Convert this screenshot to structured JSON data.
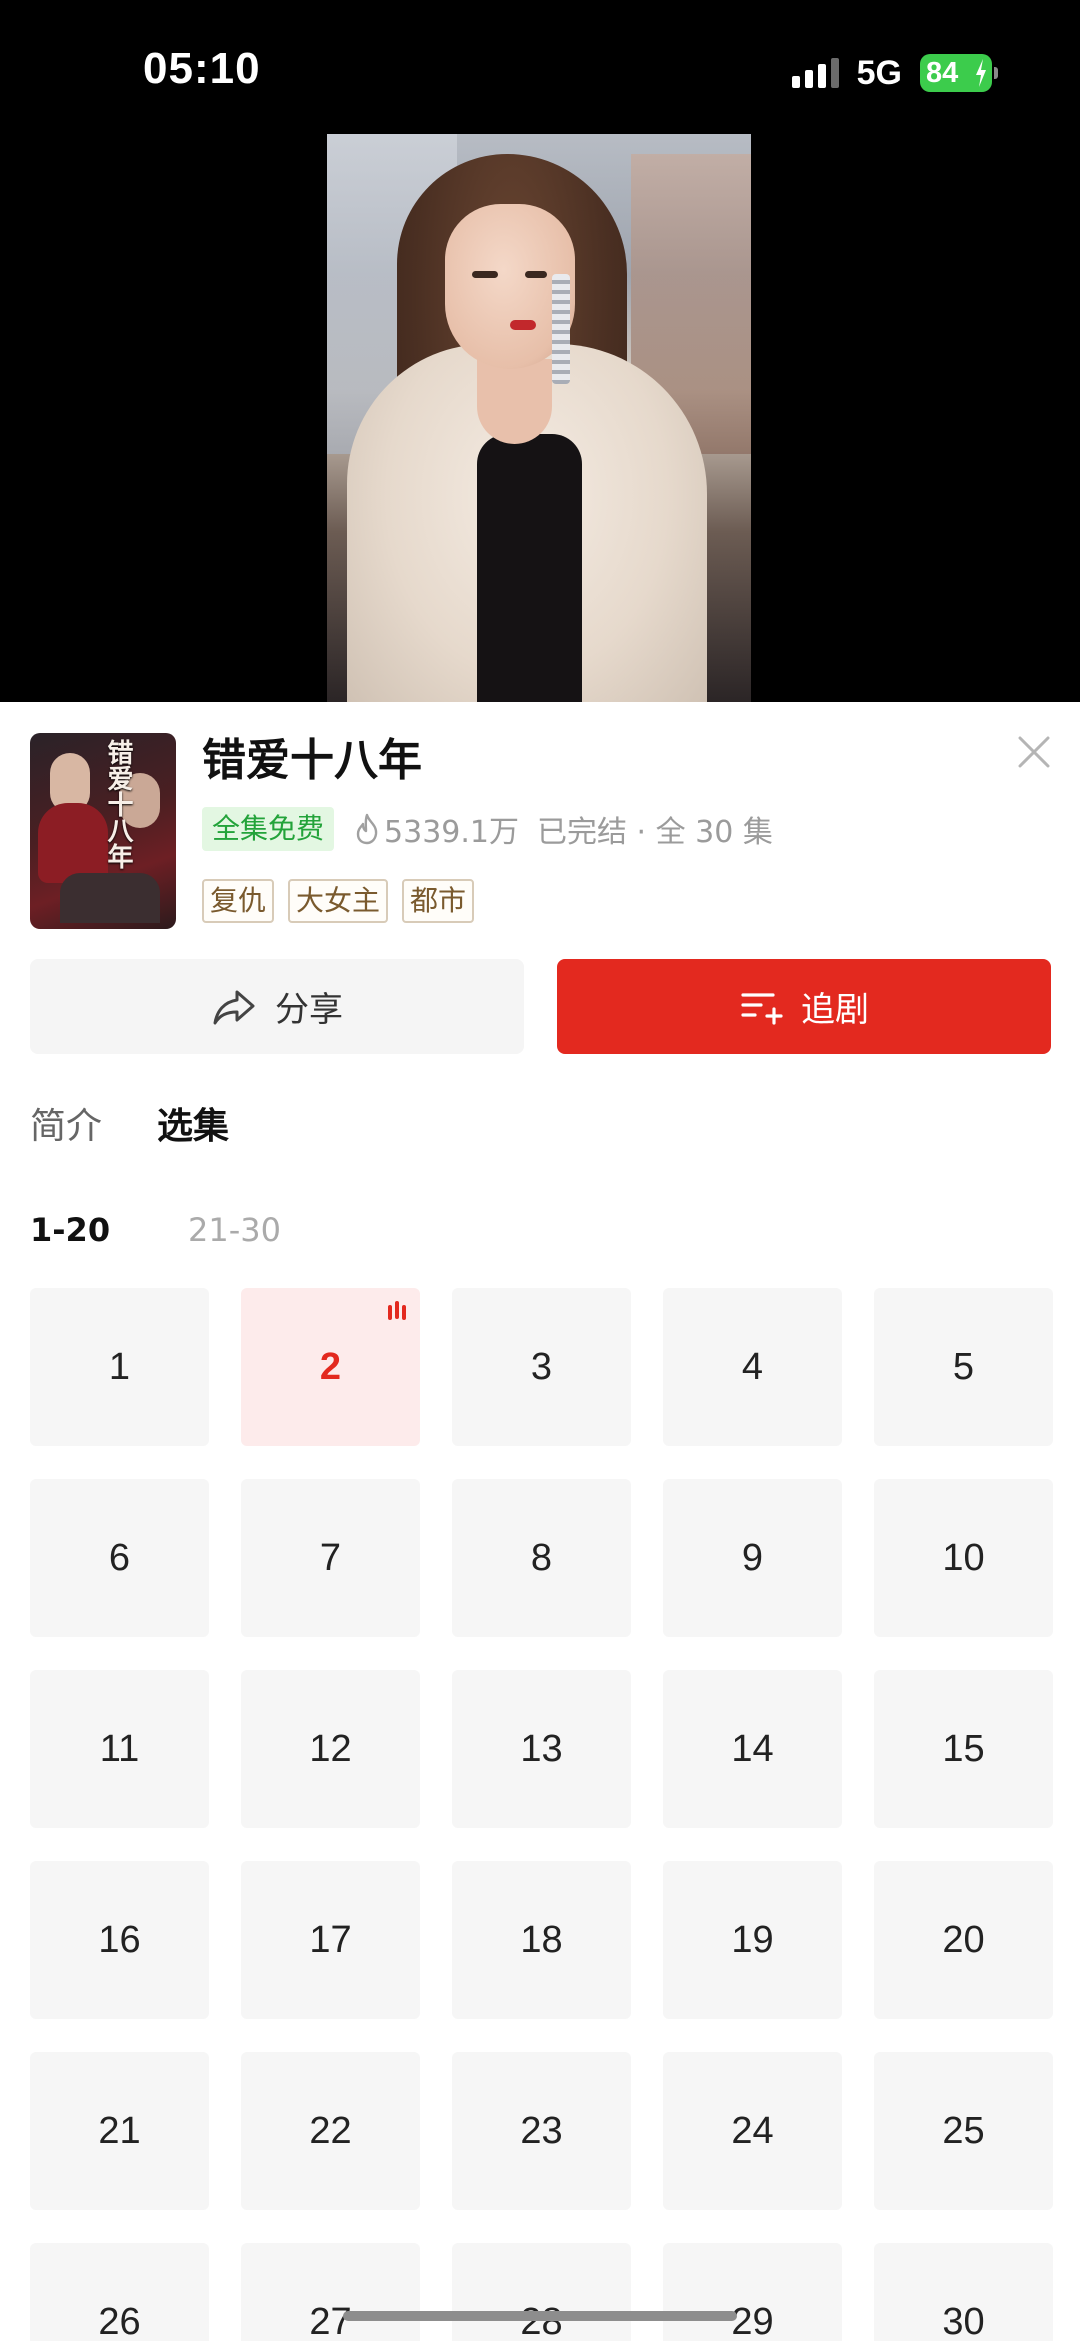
{
  "status_bar": {
    "time": "05:10",
    "network": "5G",
    "battery": "84"
  },
  "drama": {
    "cover_text": "错爱十八年",
    "title": "错爱十八年",
    "free_badge": "全集免费",
    "views": "5339.1万",
    "status": "已完结 · 全 30 集",
    "tags": [
      "复仇",
      "大女主",
      "都市"
    ]
  },
  "actions": {
    "share_label": "分享",
    "follow_label": "追剧"
  },
  "tabs": {
    "intro": "简介",
    "episodes": "选集"
  },
  "ranges": [
    "1-20",
    "21-30"
  ],
  "episodes": [
    "1",
    "2",
    "3",
    "4",
    "5",
    "6",
    "7",
    "8",
    "9",
    "10",
    "11",
    "12",
    "13",
    "14",
    "15",
    "16",
    "17",
    "18",
    "19",
    "20",
    "21",
    "22",
    "23",
    "24",
    "25",
    "26",
    "27",
    "28",
    "29",
    "30"
  ],
  "current_episode": "2",
  "icons": [
    "signal-icon",
    "battery-icon",
    "close-icon",
    "flame-icon",
    "share-icon",
    "add-to-list-icon",
    "playing-icon"
  ],
  "colors": {
    "accent": "#e3291f",
    "free_green": "#23a33a",
    "battery_green": "#3ccc4c"
  }
}
